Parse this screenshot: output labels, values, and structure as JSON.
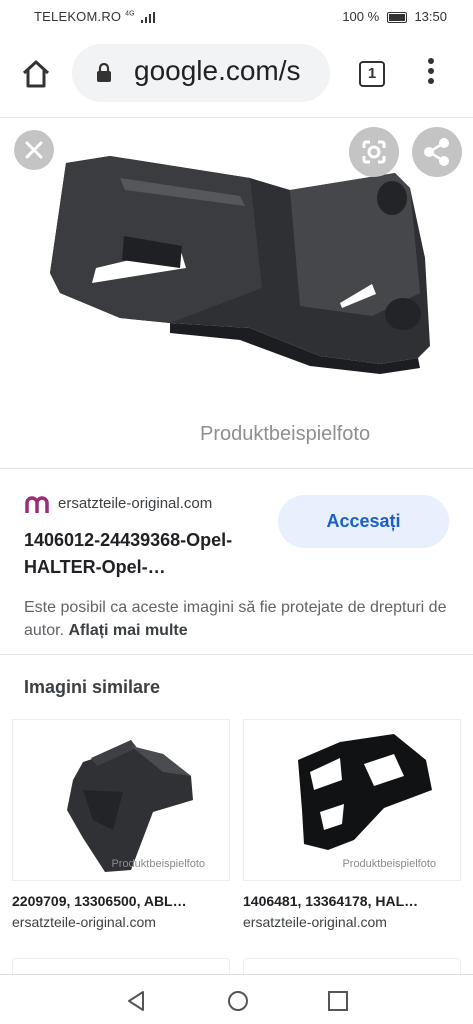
{
  "status": {
    "carrier": "TELEKOM.RO",
    "network": "4G",
    "battery": "100 %",
    "time": "13:50"
  },
  "browser": {
    "url": "google.com/s",
    "tab_count": "1"
  },
  "viewer": {
    "watermark": "Produktbeispielfoto"
  },
  "result": {
    "site": "ersatzteile-original.com",
    "title": "1406012-24439368-Opel-HALTER-Opel-…",
    "visit_label": "Accesați",
    "copyright_text": "Este posibil ca aceste imagini să fie protejate de drepturi de autor.",
    "learn_more": "Aflați mai multe"
  },
  "similar": {
    "heading": "Imagini similare",
    "items": [
      {
        "title": "2209709, 13306500, ABL…",
        "site": "ersatzteile-original.com",
        "watermark": "Produktbeispielfoto"
      },
      {
        "title": "1406481, 13364178, HAL…",
        "site": "ersatzteile-original.com",
        "watermark": "Produktbeispielfoto"
      }
    ]
  },
  "colors": {
    "accent": "#1a5fc7",
    "visit_bg": "#e8f0fe",
    "site_icon": "#9c2b7a"
  }
}
